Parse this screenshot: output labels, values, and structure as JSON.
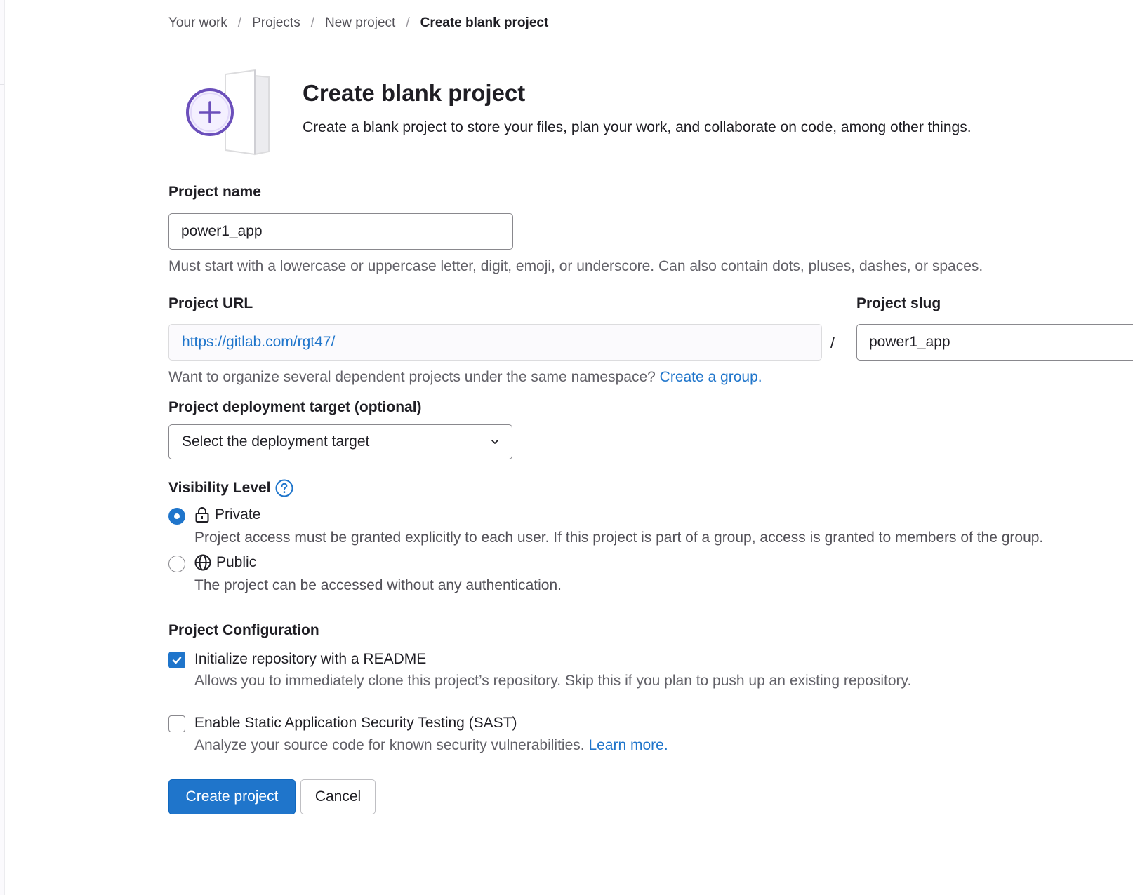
{
  "breadcrumb": {
    "items": [
      "Your work",
      "Projects",
      "New project",
      "Create blank project"
    ],
    "separator": "/"
  },
  "header": {
    "title": "Create blank project",
    "description": "Create a blank project to store your files, plan your work, and collaborate on code, among other things.",
    "illustration_icon": "plus-icon"
  },
  "project_name": {
    "label": "Project name",
    "value": "power1_app",
    "help": "Must start with a lowercase or uppercase letter, digit, emoji, or underscore. Can also contain dots, pluses, dashes, or spaces."
  },
  "project_url": {
    "label": "Project URL",
    "prefix": "https://gitlab.com/rgt47/",
    "separator": "/",
    "help_text": "Want to organize several dependent projects under the same namespace?",
    "help_link": "Create a group."
  },
  "project_slug": {
    "label": "Project slug",
    "value": "power1_app"
  },
  "deployment_target": {
    "label": "Project deployment target (optional)",
    "selected": "Select the deployment target"
  },
  "visibility": {
    "label": "Visibility Level",
    "options": [
      {
        "label": "Private",
        "icon": "lock-icon",
        "checked": true,
        "description": "Project access must be granted explicitly to each user. If this project is part of a group, access is granted to members of the group."
      },
      {
        "label": "Public",
        "icon": "globe-icon",
        "checked": false,
        "description": "The project can be accessed without any authentication."
      }
    ]
  },
  "configuration": {
    "label": "Project Configuration",
    "readme": {
      "label": "Initialize repository with a README",
      "checked": true,
      "description": "Allows you to immediately clone this project’s repository. Skip this if you plan to push up an existing repository."
    },
    "sast": {
      "label": "Enable Static Application Security Testing (SAST)",
      "checked": false,
      "description": "Analyze your source code for known security vulnerabilities.",
      "link": "Learn more."
    }
  },
  "actions": {
    "create": "Create project",
    "cancel": "Cancel"
  },
  "colors": {
    "primary": "#1f75cb",
    "text": "#1f1e24",
    "muted": "#626168",
    "illustration_accent": "#6b4fbb"
  }
}
